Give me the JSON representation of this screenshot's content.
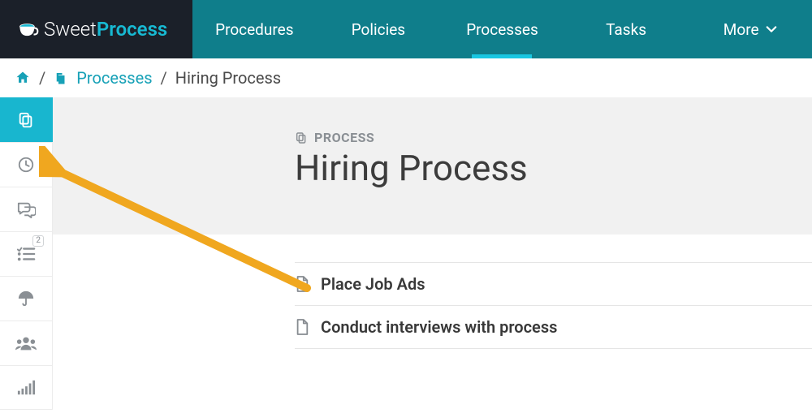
{
  "brand": {
    "thin": "Sweet",
    "bold": "Process"
  },
  "nav": {
    "items": [
      {
        "label": "Procedures"
      },
      {
        "label": "Policies"
      },
      {
        "label": "Processes"
      },
      {
        "label": "Tasks"
      },
      {
        "label": "More"
      }
    ]
  },
  "breadcrumb": {
    "link": "Processes",
    "current": "Hiring Process"
  },
  "sidebar": {
    "badge": "2"
  },
  "page": {
    "kicker": "PROCESS",
    "title": "Hiring Process"
  },
  "steps": [
    {
      "label": "Place Job Ads"
    },
    {
      "label": "Conduct interviews with process"
    }
  ]
}
